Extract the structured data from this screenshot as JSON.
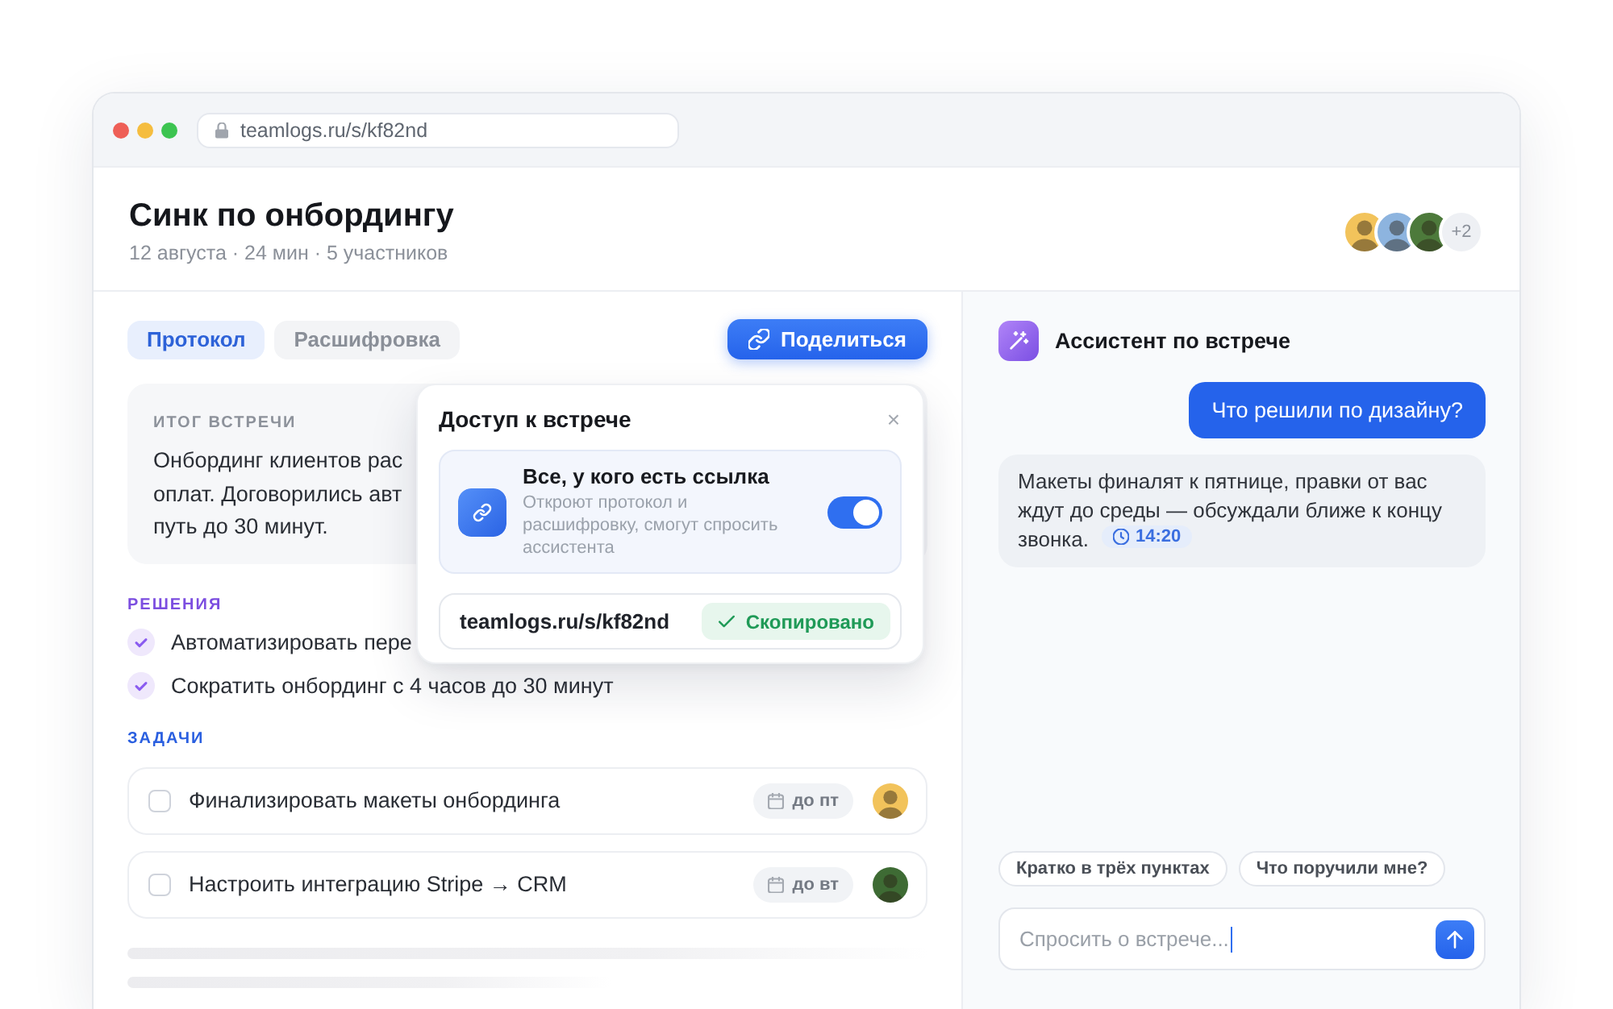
{
  "browser": {
    "url": "teamlogs.ru/s/kf82nd"
  },
  "header": {
    "title": "Синк по онбордингу",
    "meta": "12 августа · 24 мин · 5 участников",
    "avatars": [
      {
        "color": "#f2c35b"
      },
      {
        "color": "#8db4df"
      },
      {
        "color": "#4d7a3b"
      }
    ],
    "more": "+2"
  },
  "tabs": [
    {
      "label": "Протокол",
      "selected": true
    },
    {
      "label": "Расшифровка",
      "selected": false
    }
  ],
  "share_button": {
    "label": "Поделиться"
  },
  "summary": {
    "heading": "ИТОГ ВСТРЕЧИ",
    "text": "Онбординг клиентов рас\nоплат. Договорились авт\nпуть до 30 минут."
  },
  "decisions": {
    "heading": "РЕШЕНИЯ",
    "items": [
      "Автоматизировать пере",
      "Сократить онбординг с 4 часов до 30 минут"
    ]
  },
  "tasks": {
    "heading": "ЗАДАЧИ",
    "items": [
      {
        "text": "Финализировать макеты онбординга",
        "checked": false,
        "due": "до пт",
        "color": "#f2c35b"
      },
      {
        "text": "Настроить интеграцию Stripe → CRM",
        "checked": false,
        "due": "до вт",
        "color": "#3e6b34"
      }
    ]
  },
  "share_popover": {
    "title": "Доступ к встрече",
    "close": "×",
    "access": {
      "title": "Все, у кого есть ссылка",
      "description": "Откроют протокол и расшифровку, смогут спросить ассистента",
      "on": true
    },
    "link": {
      "url": "teamlogs.ru/s/kf82nd",
      "status": "Скопировано"
    }
  },
  "assistant": {
    "title": "Ассистент по встрече",
    "messages": [
      {
        "kind": "user",
        "text": "Что решили по дизайну?"
      },
      {
        "kind": "assistant",
        "text": "Макеты финалят к пятнице, правки от вас ждут до среды — обсуждали ближе к концу звонка.",
        "timestamp": "14:20"
      }
    ],
    "suggestions": [
      "Кратко в трёх пунктах",
      "Что поручили мне?"
    ],
    "input": {
      "placeholder": "Спросить о встрече..."
    }
  }
}
